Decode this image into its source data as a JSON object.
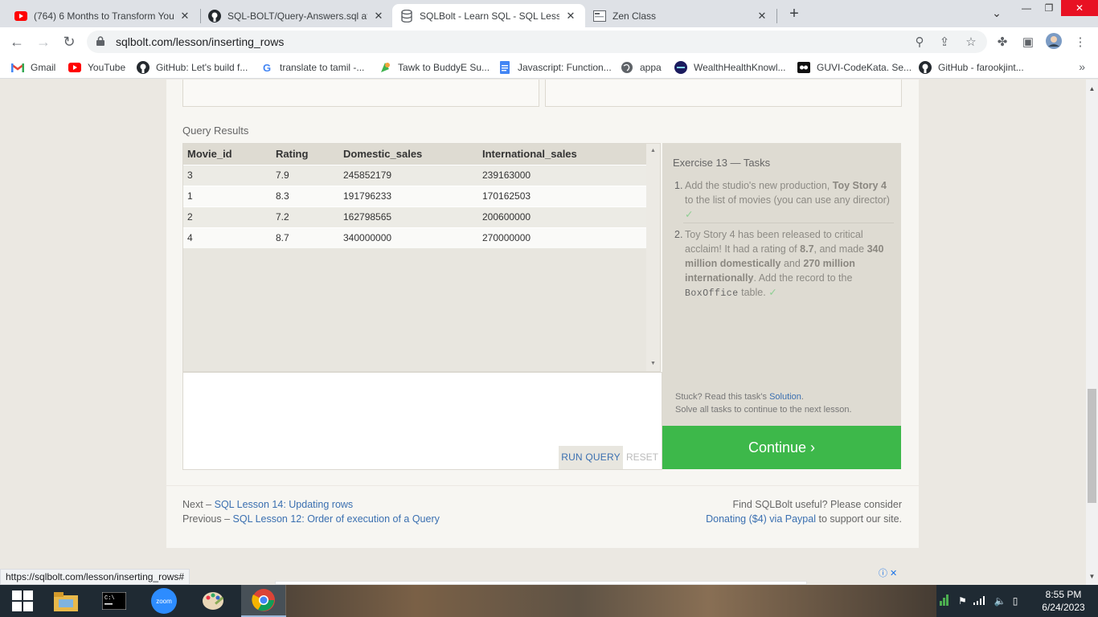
{
  "tabs": [
    {
      "title": "(764) 6 Months to Transform You",
      "icon": "youtube-icon",
      "active": false
    },
    {
      "title": "SQL-BOLT/Query-Answers.sql at",
      "icon": "github-icon",
      "active": false
    },
    {
      "title": "SQLBolt - Learn SQL - SQL Lessor",
      "icon": "database-icon",
      "active": true
    },
    {
      "title": "Zen Class",
      "icon": "page-icon",
      "active": false
    }
  ],
  "window": {
    "minimize": "—",
    "restore": "❐",
    "close": "✕"
  },
  "address": {
    "url": "sqlbolt.com/lesson/inserting_rows"
  },
  "bookmarks": [
    {
      "label": "Gmail",
      "icon": "gmail-icon"
    },
    {
      "label": "YouTube",
      "icon": "youtube-icon"
    },
    {
      "label": "GitHub: Let's build f...",
      "icon": "github-icon"
    },
    {
      "label": "translate to tamil -...",
      "icon": "google-icon"
    },
    {
      "label": "Tawk to BuddyE Su...",
      "icon": "tawk-icon"
    },
    {
      "label": "Javascript: Function...",
      "icon": "docs-icon"
    },
    {
      "label": "appa",
      "icon": "globe-icon"
    },
    {
      "label": "WealthHealthKnowl...",
      "icon": "circle-logo-icon"
    },
    {
      "label": "GUVI-CodeKata. Se...",
      "icon": "guvi-icon"
    },
    {
      "label": "GitHub - farookjint...",
      "icon": "github-icon"
    }
  ],
  "query_results": {
    "label": "Query Results",
    "columns": [
      "Movie_id",
      "Rating",
      "Domestic_sales",
      "International_sales"
    ],
    "rows": [
      [
        "3",
        "7.9",
        "245852179",
        "239163000"
      ],
      [
        "1",
        "8.3",
        "191796233",
        "170162503"
      ],
      [
        "2",
        "7.2",
        "162798565",
        "200600000"
      ],
      [
        "4",
        "8.7",
        "340000000",
        "270000000"
      ]
    ]
  },
  "editor": {
    "run_label": "RUN QUERY",
    "reset_label": "RESET"
  },
  "tasks": {
    "title": "Exercise 13 — Tasks",
    "task1": {
      "num": "1.",
      "t1": "Add the studio's new production,",
      "b1": "Toy Story 4",
      "t2": "to the list of movies (you can use any director)",
      "check": "✓"
    },
    "task2": {
      "num": "2.",
      "t1": "Toy Story 4 has been released to critical acclaim! It had a rating of",
      "b1": "8.7",
      "t2": ", and made",
      "b2": "340 million domestically",
      "t3": "and",
      "b3": "270 million internationally",
      "t4": ". Add the record to the",
      "code": "BoxOffice",
      "t5": "table.",
      "check": "✓"
    },
    "stuck_text": "Stuck? Read this task's",
    "solution_link": "Solution",
    "stuck_end": ".",
    "solve_all": "Solve all tasks to continue to the next lesson."
  },
  "continue_label": "Continue ›",
  "footer": {
    "next_prefix": "Next –",
    "next_link": "SQL Lesson 14: Updating rows",
    "prev_prefix": "Previous –",
    "prev_link": "SQL Lesson 12: Order of execution of a Query",
    "useful": "Find SQLBolt useful? Please consider",
    "donate_link": "Donating ($4) via Paypal",
    "support": "to support our site."
  },
  "status_url": "https://sqlbolt.com/lesson/inserting_rows#",
  "taskbar": {
    "items": [
      "start-icon",
      "file-explorer-icon",
      "cmd-icon",
      "zoom-icon",
      "paint-icon",
      "chrome-icon"
    ],
    "zoom_label": "zoom",
    "time": "8:55 PM",
    "date": "6/24/2023"
  },
  "colors": {
    "accent_green": "#3db84a",
    "link_blue": "#3a6fb0",
    "check_green": "#8fcf94"
  }
}
